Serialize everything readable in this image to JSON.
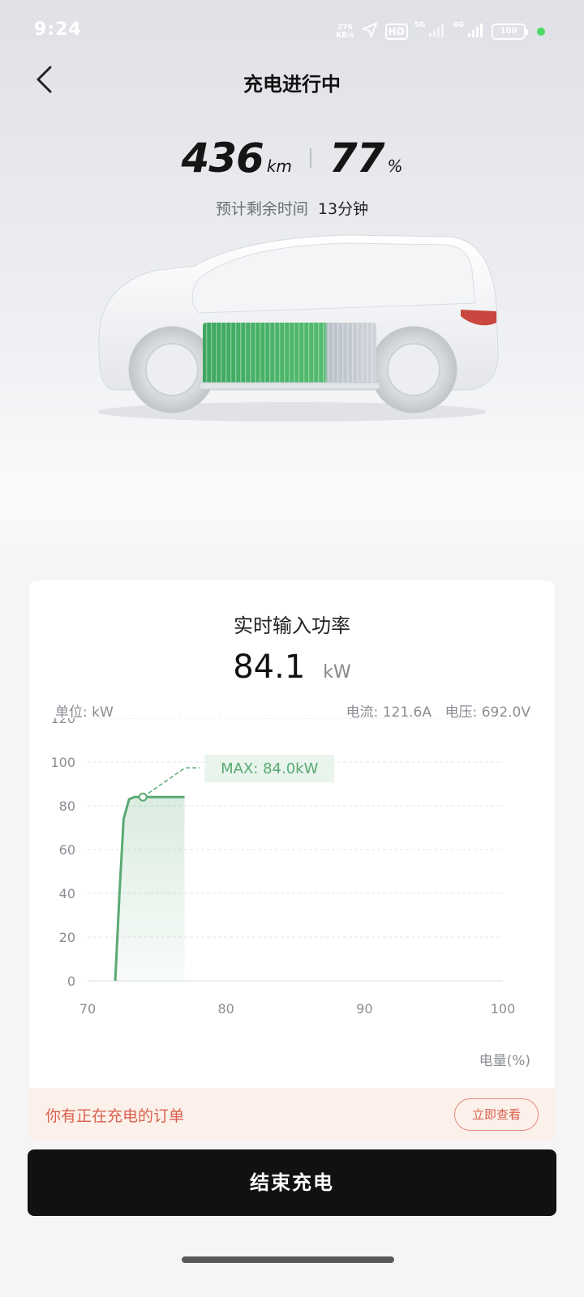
{
  "status_bar": {
    "time": "9:24",
    "net_speed_value": "276",
    "net_speed_unit": "KB/s",
    "hd": "HD",
    "sig1": "5G",
    "sig2": "4G",
    "battery": "100",
    "icons": [
      "location-arrow-icon",
      "signal-icon",
      "battery-icon"
    ]
  },
  "header": {
    "title": "充电进行中"
  },
  "stats": {
    "range_value": "436",
    "range_unit": "km",
    "soc_value": "77",
    "soc_unit": "%",
    "remaining_label": "预计剩余时间",
    "remaining_value": "13分钟"
  },
  "card": {
    "title": "实时输入功率",
    "power_value": "84.1",
    "power_unit": "kW",
    "unit_label": "单位: kW",
    "current_label": "电流: 121.6A",
    "voltage_label": "电压: 692.0V",
    "x_axis_label": "电量(%)"
  },
  "chart_data": {
    "type": "line",
    "xlabel": "电量(%)",
    "ylabel": "单位: kW",
    "xlim": [
      70,
      100
    ],
    "ylim": [
      0,
      120
    ],
    "x_ticks": [
      70,
      80,
      90,
      100
    ],
    "y_ticks": [
      0,
      20,
      40,
      60,
      80,
      100,
      120
    ],
    "grid": true,
    "series": [
      {
        "points": [
          [
            72,
            0
          ],
          [
            72.3,
            40
          ],
          [
            72.6,
            74
          ],
          [
            73,
            83
          ],
          [
            73.4,
            84
          ],
          [
            74,
            84
          ],
          [
            75,
            84
          ],
          [
            76,
            84
          ],
          [
            77,
            84
          ]
        ]
      }
    ],
    "annotation": {
      "text": "MAX: 84.0kW",
      "x": 74,
      "y": 84
    },
    "colors": {
      "line": "#5aa973",
      "fill": "#5aa973"
    }
  },
  "order": {
    "text": "你有正在充电的订单",
    "button": "立即查看"
  },
  "end_button": "结束充电"
}
